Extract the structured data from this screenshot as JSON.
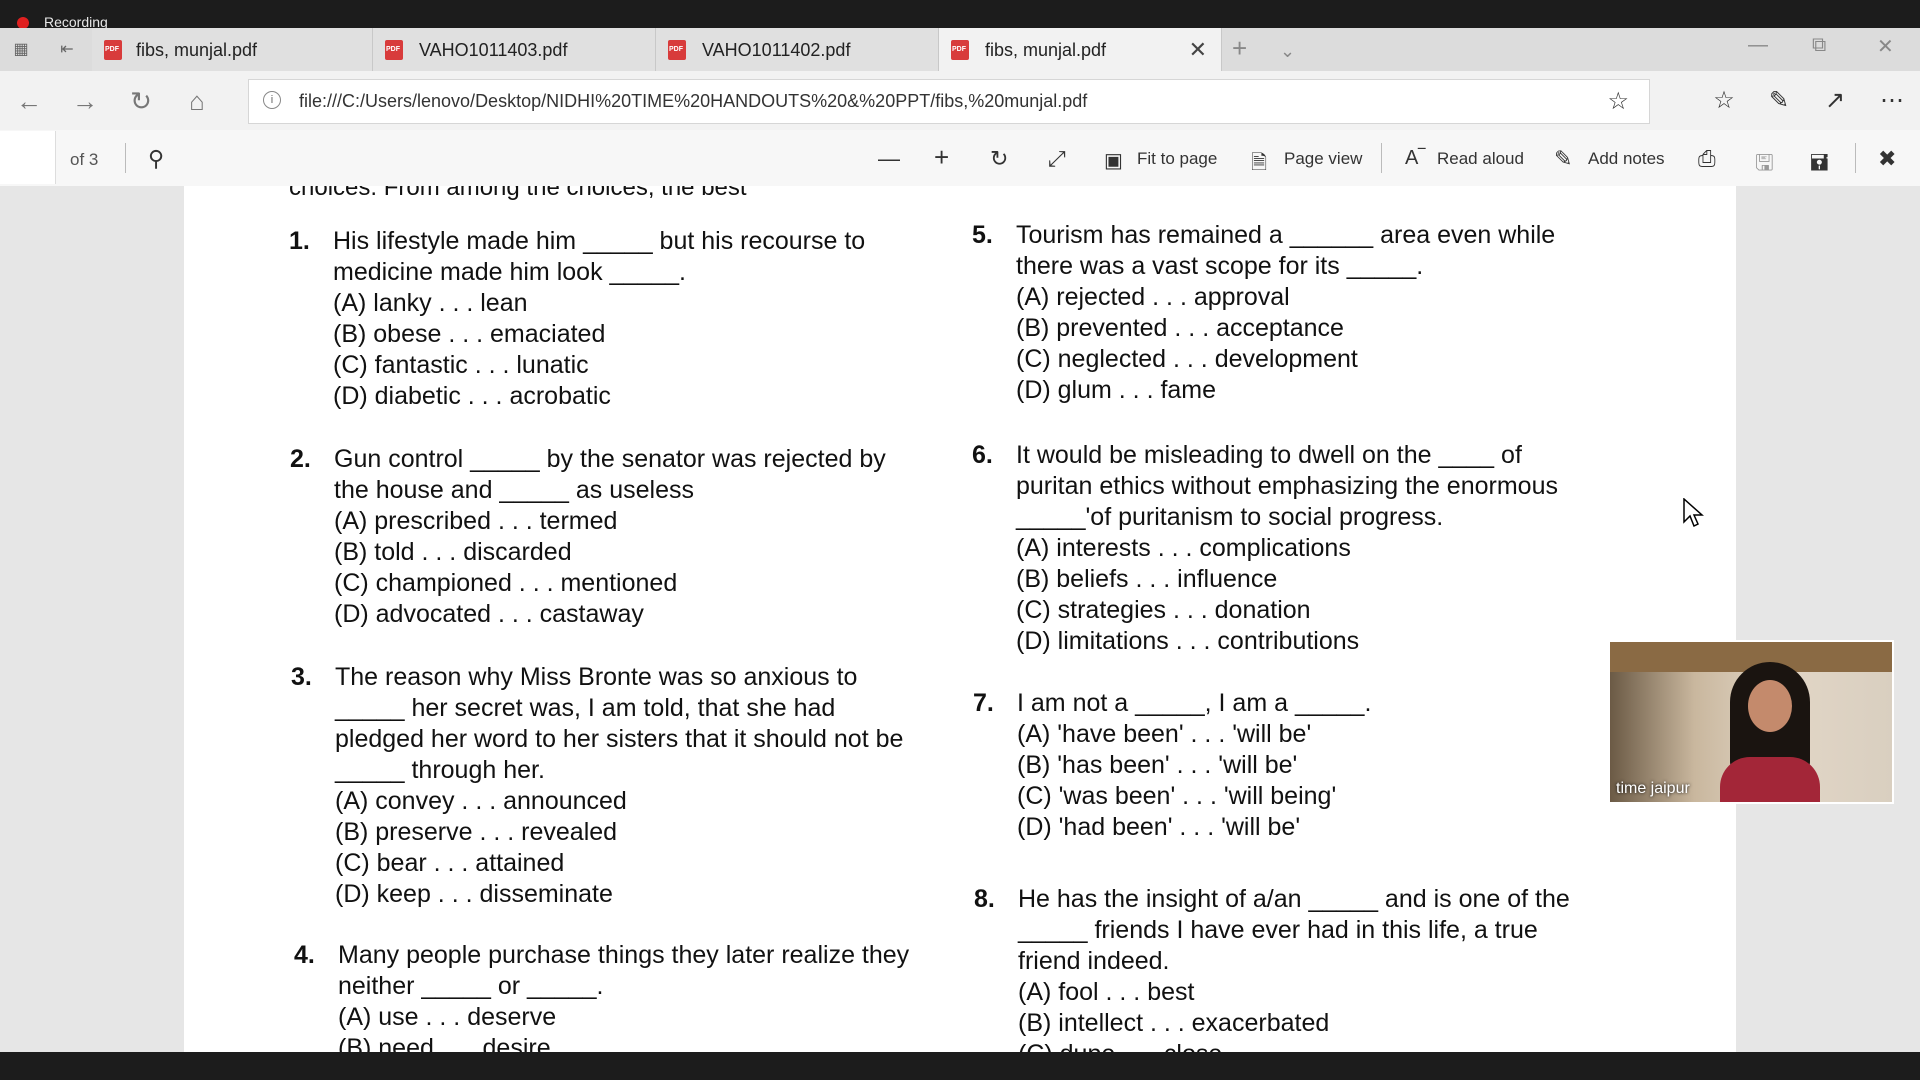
{
  "recording": {
    "label": "Recording"
  },
  "tabs": [
    {
      "title": "fibs, munjal.pdf"
    },
    {
      "title": "VAHO1011403.pdf"
    },
    {
      "title": "VAHO1011402.pdf"
    },
    {
      "title": "fibs, munjal.pdf",
      "active": true
    }
  ],
  "pdf_badge": "PDF",
  "address": {
    "url": "file:///C:/Users/lenovo/Desktop/NIDHI%20TIME%20HANDOUTS%20&%20PPT/fibs,%20munjal.pdf"
  },
  "pdf_toolbar": {
    "page_count": "of 3",
    "fit_to_page": "Fit to page",
    "page_view": "Page view",
    "read_aloud": "Read aloud",
    "add_notes": "Add notes"
  },
  "document": {
    "cut_line": "choices. From among the choices, the best",
    "questions": [
      {
        "num": "1.",
        "lines": [
          "His lifestyle made him _____ but his recourse to",
          "medicine made him look _____."
        ],
        "options": [
          "(A)  lanky . . . lean",
          "(B)  obese . . . emaciated",
          "(C)  fantastic . . . lunatic",
          "(D)  diabetic . . . acrobatic"
        ]
      },
      {
        "num": "2.",
        "lines": [
          "Gun control _____ by the senator was rejected by",
          "the house and _____ as useless"
        ],
        "options": [
          "(A)  prescribed . . . termed",
          "(B)  told . . . discarded",
          "(C)  championed . . . mentioned",
          "(D)  advocated . . . castaway"
        ]
      },
      {
        "num": "3.",
        "lines": [
          "The reason why Miss Bronte was so anxious to",
          "_____ her secret was, I am told, that she had",
          "pledged her word to her sisters that it should not be",
          "_____ through her."
        ],
        "options": [
          "(A)  convey . . . announced",
          "(B)  preserve . . . revealed",
          "(C)  bear . . . attained",
          "(D)  keep . . . disseminate"
        ]
      },
      {
        "num": "4.",
        "lines": [
          "Many people purchase things they later realize they",
          "neither _____ or _____."
        ],
        "options": [
          "(A)  use . . . deserve",
          "(B)  need . . . desire"
        ]
      },
      {
        "num": "5.",
        "lines": [
          "Tourism has remained a ______ area even while",
          "there was a vast scope for its _____."
        ],
        "options": [
          "(A)  rejected . . . approval",
          "(B)  prevented . . . acceptance",
          "(C)  neglected . . . development",
          "(D)  glum . . . fame"
        ]
      },
      {
        "num": "6.",
        "lines": [
          "It would be misleading to dwell on the ____ of",
          "puritan ethics without emphasizing the enormous",
          "_____'of puritanism to social progress."
        ],
        "options": [
          "(A)  interests . . . complications",
          "(B)  beliefs . . . influence",
          "(C)  strategies . . . donation",
          "(D)  limitations . . . contributions"
        ]
      },
      {
        "num": "7.",
        "lines": [
          "I am not a _____, I am a _____."
        ],
        "options": [
          "(A)  'have been' . . . 'will be'",
          "(B)  'has been' . . . 'will be'",
          "(C)  'was been' . . . 'will being'",
          "(D)  'had been' . . . 'will be'"
        ]
      },
      {
        "num": "8.",
        "lines": [
          "He has the insight of a/an _____ and is one of the",
          "_____ friends I have ever had in this life, a true",
          "friend indeed."
        ],
        "options": [
          "(A)  fool . . . best",
          "(B)  intellect . . . exacerbated",
          "(C)  dupe . . . close"
        ]
      }
    ]
  },
  "video": {
    "participant": "time jaipur"
  }
}
